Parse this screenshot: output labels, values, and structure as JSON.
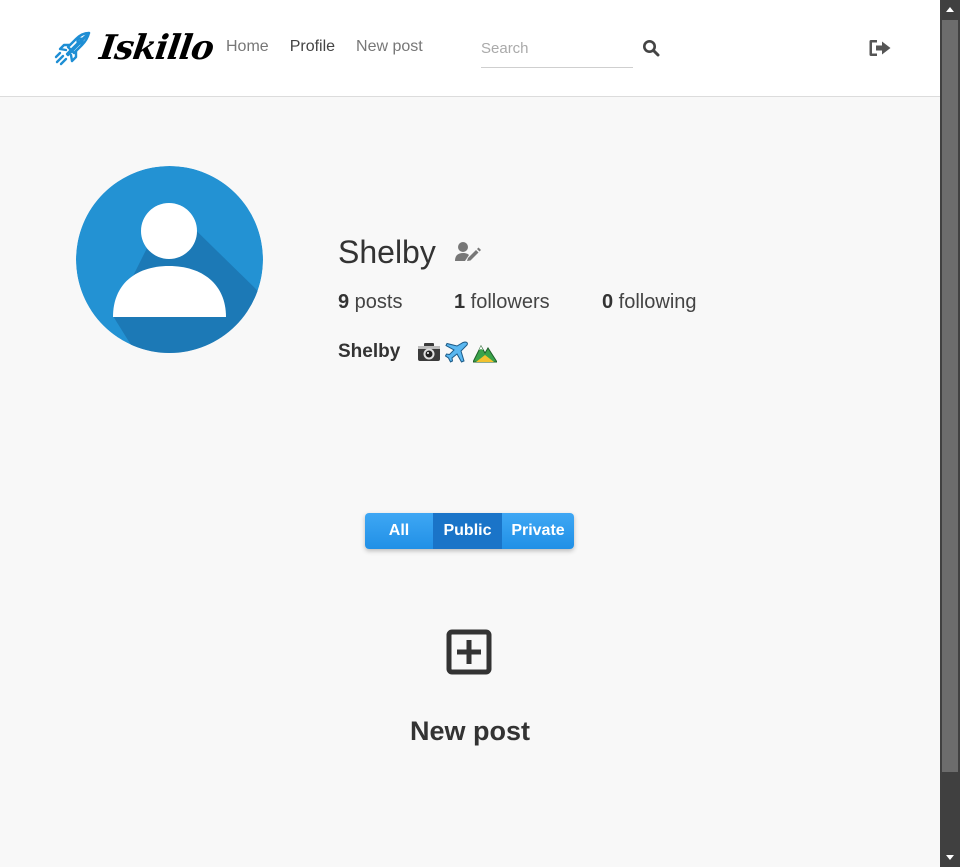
{
  "header": {
    "logo_text": "Iskillo",
    "nav": {
      "home": "Home",
      "profile": "Profile",
      "new_post": "New post"
    },
    "search": {
      "placeholder": "Search"
    }
  },
  "profile": {
    "username": "Shelby",
    "stats": {
      "posts_count": "9",
      "posts_label": " posts",
      "followers_count": "1",
      "followers_label": " followers",
      "following_count": "0",
      "following_label": " following"
    },
    "bio_name": "Shelby",
    "bio_emojis": [
      "camera-emoji",
      "airplane-emoji",
      "mountain-emoji"
    ]
  },
  "filters": {
    "all": "All",
    "public": "Public",
    "private": "Private",
    "selected": "Public"
  },
  "new_post": {
    "label": "New post"
  },
  "colors": {
    "accent": "#2196F3",
    "accent_dark": "#1a74c8",
    "avatar_bg": "#2392D3",
    "avatar_shadow": "#1B74B0"
  }
}
